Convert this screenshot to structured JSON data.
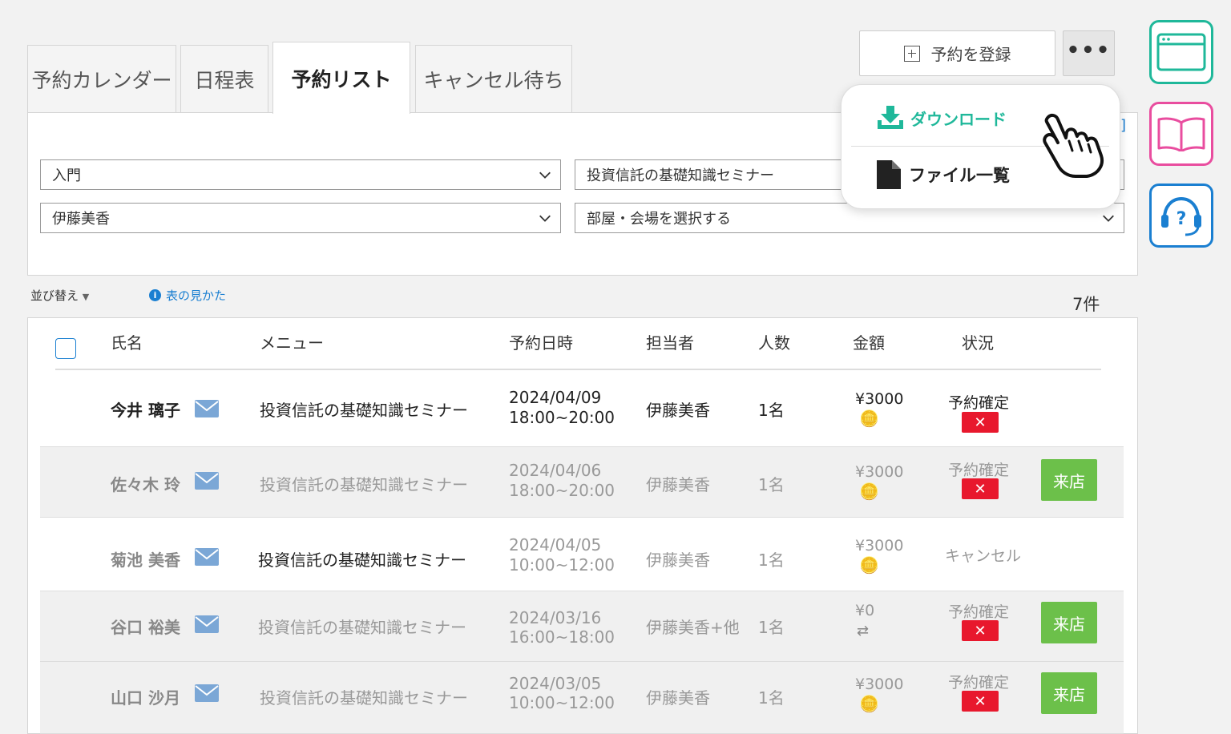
{
  "tabs": [
    "予約カレンダー",
    "日程表",
    "予約リスト",
    "キャンセル待ち"
  ],
  "top_actions": {
    "register_label": "予約を登録"
  },
  "dropdown_menu": {
    "download_label": "ダウンロード",
    "files_label": "ファイル一覧"
  },
  "filters": {
    "category": "入門",
    "menu": "投資信託の基礎知識セミナー",
    "staff": "伊藤美香",
    "room_placeholder": "部屋・会場を選択する"
  },
  "toolbar": {
    "sort_label": "並び替え",
    "help_label": "表の見かた",
    "count": "7件"
  },
  "table": {
    "headers": {
      "name": "氏名",
      "menu": "メニュー",
      "datetime": "予約日時",
      "staff": "担当者",
      "people": "人数",
      "amount": "金額",
      "status": "状況"
    },
    "rows": [
      {
        "name": "今井 璃子",
        "menu": "投資信託の基礎知識セミナー",
        "date": "2024/04/09",
        "time": "18:00~20:00",
        "staff": "伊藤美香",
        "people": "1名",
        "amount": "¥3000",
        "status": "予約確定",
        "visit": ""
      },
      {
        "name": "佐々木 玲",
        "menu": "投資信託の基礎知識セミナー",
        "date": "2024/04/06",
        "time": "18:00~20:00",
        "staff": "伊藤美香",
        "people": "1名",
        "amount": "¥3000",
        "status": "予約確定",
        "visit": "来店"
      },
      {
        "name": "菊池 美香",
        "menu": "投資信託の基礎知識セミナー",
        "date": "2024/04/05",
        "time": "10:00~12:00",
        "staff": "伊藤美香",
        "people": "1名",
        "amount": "¥3000",
        "status": "キャンセル",
        "visit": ""
      },
      {
        "name": "谷口 裕美",
        "menu": "投資信託の基礎知識セミナー",
        "date": "2024/03/16",
        "time": "16:00~18:00",
        "staff": "伊藤美香+他",
        "people": "1名",
        "amount": "¥0",
        "status": "予約確定",
        "visit": "来店"
      },
      {
        "name": "山口 沙月",
        "menu": "投資信託の基礎知識セミナー",
        "date": "2024/03/05",
        "time": "10:00~12:00",
        "staff": "伊藤美香",
        "people": "1名",
        "amount": "¥3000",
        "status": "予約確定",
        "visit": "来店"
      }
    ]
  },
  "colors": {
    "accent_green": "#1fb89a",
    "pink": "#e94d9f",
    "blue": "#1a7fd1",
    "red": "#e8182d",
    "visit_green": "#6cc04a"
  }
}
